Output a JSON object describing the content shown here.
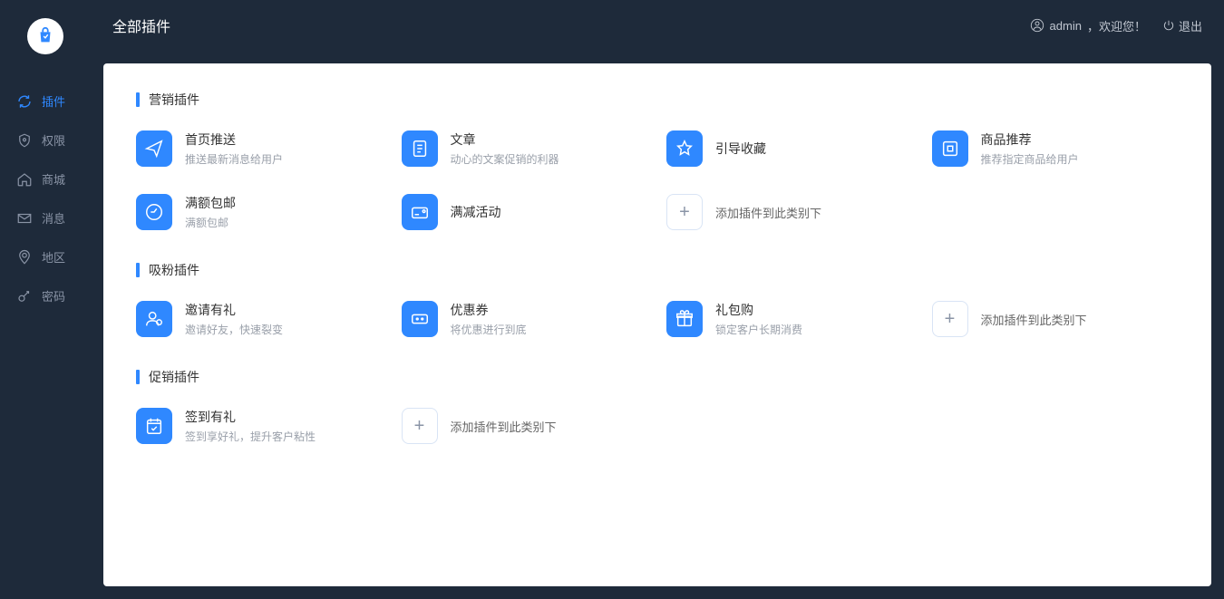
{
  "header": {
    "title": "全部插件",
    "user_prefix": "admin",
    "user_welcome": "，欢迎您！",
    "logout": "退出"
  },
  "sidebar": {
    "items": [
      {
        "label": "插件",
        "icon": "refresh",
        "active": true
      },
      {
        "label": "权限",
        "icon": "shield",
        "active": false
      },
      {
        "label": "商城",
        "icon": "home",
        "active": false
      },
      {
        "label": "消息",
        "icon": "mail",
        "active": false
      },
      {
        "label": "地区",
        "icon": "map-pin",
        "active": false
      },
      {
        "label": "密码",
        "icon": "key",
        "active": false
      }
    ]
  },
  "sections": [
    {
      "title": "营销插件",
      "plugins": [
        {
          "title": "首页推送",
          "desc": "推送最新消息给用户",
          "icon": "send"
        },
        {
          "title": "文章",
          "desc": "动心的文案促销的利器",
          "icon": "doc"
        },
        {
          "title": "引导收藏",
          "desc": "",
          "icon": "star"
        },
        {
          "title": "商品推荐",
          "desc": "推荐指定商品给用户",
          "icon": "box"
        },
        {
          "title": "满额包邮",
          "desc": "满额包邮",
          "icon": "truck"
        },
        {
          "title": "满减活动",
          "desc": "",
          "icon": "card"
        },
        {
          "add": true,
          "title": "添加插件到此类别下"
        }
      ]
    },
    {
      "title": "吸粉插件",
      "plugins": [
        {
          "title": "邀请有礼",
          "desc": "邀请好友，快速裂变",
          "icon": "user-add"
        },
        {
          "title": "优惠券",
          "desc": "将优惠进行到底",
          "icon": "ticket"
        },
        {
          "title": "礼包购",
          "desc": "锁定客户长期消费",
          "icon": "gift"
        },
        {
          "add": true,
          "title": "添加插件到此类别下"
        }
      ]
    },
    {
      "title": "促销插件",
      "plugins": [
        {
          "title": "签到有礼",
          "desc": "签到享好礼，提升客户粘性",
          "icon": "calendar"
        },
        {
          "add": true,
          "title": "添加插件到此类别下"
        }
      ]
    }
  ]
}
